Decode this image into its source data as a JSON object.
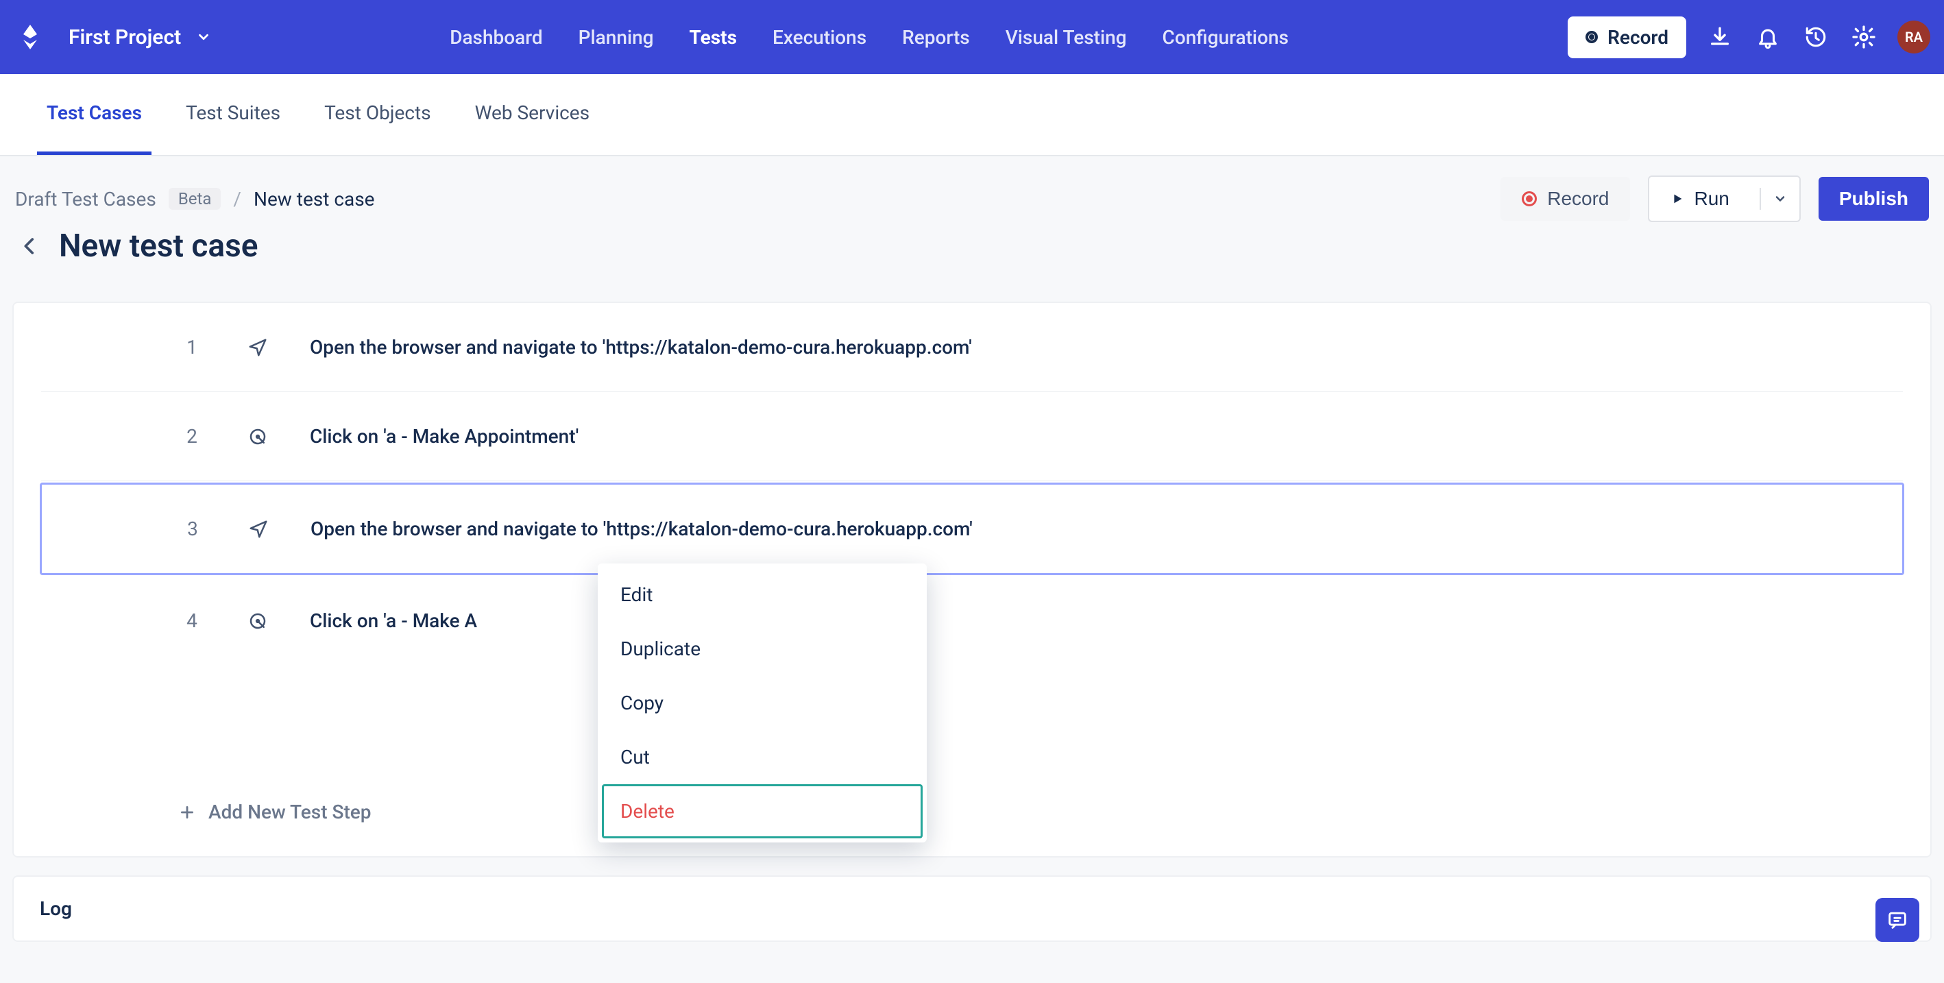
{
  "project_name": "First Project",
  "topnav": {
    "dashboard": "Dashboard",
    "planning": "Planning",
    "tests": "Tests",
    "executions": "Executions",
    "reports": "Reports",
    "visual_testing": "Visual Testing",
    "configurations": "Configurations"
  },
  "topbar": {
    "record_label": "Record",
    "avatar_initials": "RA"
  },
  "subtabs": {
    "test_cases": "Test Cases",
    "test_suites": "Test Suites",
    "test_objects": "Test Objects",
    "web_services": "Web Services"
  },
  "breadcrumb": {
    "draft": "Draft Test Cases",
    "beta": "Beta",
    "sep": "/",
    "current": "New test case"
  },
  "page_title": "New test case",
  "actions": {
    "record": "Record",
    "run": "Run",
    "publish": "Publish"
  },
  "steps": [
    {
      "num": "1",
      "type": "navigate",
      "text": "Open the browser and navigate to 'https://katalon-demo-cura.herokuapp.com'"
    },
    {
      "num": "2",
      "type": "click",
      "text": "Click on 'a - Make Appointment'"
    },
    {
      "num": "3",
      "type": "navigate",
      "text": "Open the browser and navigate to 'https://katalon-demo-cura.herokuapp.com'"
    },
    {
      "num": "4",
      "type": "click",
      "text": "Click on 'a - Make A"
    }
  ],
  "add_step_label": "Add New Test Step",
  "context_menu": {
    "edit": "Edit",
    "duplicate": "Duplicate",
    "copy": "Copy",
    "cut": "Cut",
    "delete": "Delete"
  },
  "log_title": "Log"
}
